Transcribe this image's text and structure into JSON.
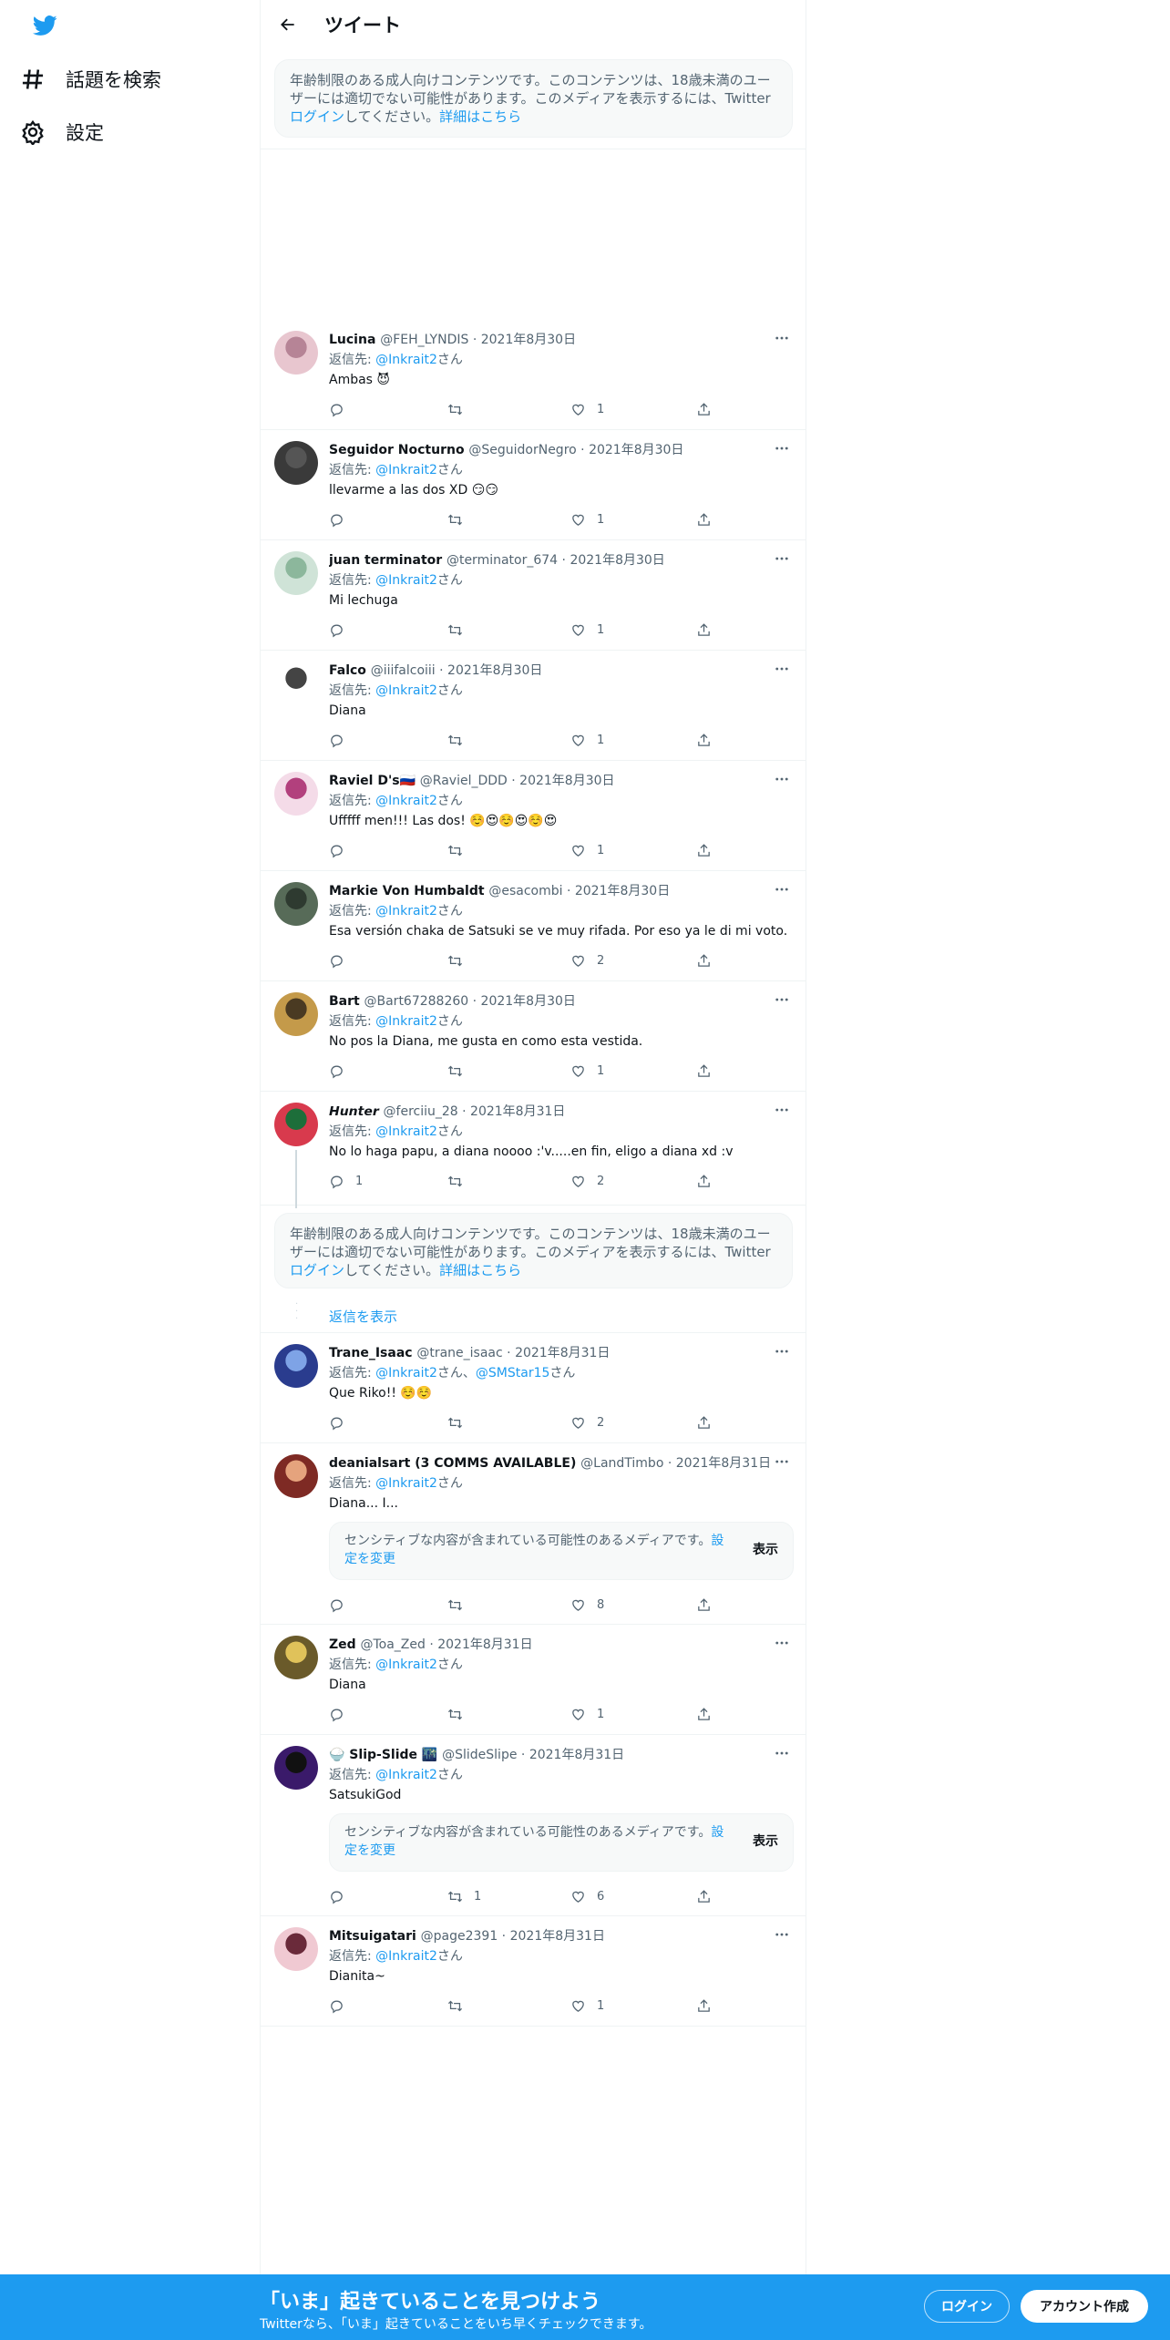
{
  "nav": {
    "explore": "話題を検索",
    "settings": "設定"
  },
  "header": {
    "title": "ツイート"
  },
  "age_notice": {
    "text1": "年齢制限のある成人向けコンテンツです。このコンテンツは、18歳未満のユーザーには適切でない可能性があります。このメディアを表示するには、Twitter",
    "login": "ログイン",
    "text2": "してください。",
    "details": "詳細はこちら"
  },
  "tweets": [
    {
      "name": "Lucina",
      "handle": "@FEH_LYNDIS",
      "date": "2021年8月30日",
      "reply_prefix": "返信先: ",
      "reply_to": "@Inkrait2",
      "reply_suffix": "さん",
      "text": "Ambas 😈",
      "replies": "",
      "retweets": "",
      "likes": "1"
    },
    {
      "name": "Seguidor Nocturno",
      "handle": "@SeguidorNegro",
      "date": "2021年8月30日",
      "reply_prefix": "返信先: ",
      "reply_to": "@Inkrait2",
      "reply_suffix": "さん",
      "text": "llevarme a las dos XD 😏😏",
      "replies": "",
      "retweets": "",
      "likes": "1"
    },
    {
      "name": "juan terminator",
      "handle": "@terminator_674",
      "date": "2021年8月30日",
      "reply_prefix": "返信先: ",
      "reply_to": "@Inkrait2",
      "reply_suffix": "さん",
      "text": "Mi lechuga",
      "replies": "",
      "retweets": "",
      "likes": "1"
    },
    {
      "name": "Falco",
      "handle": "@iiifalcoiii",
      "date": "2021年8月30日",
      "reply_prefix": "返信先: ",
      "reply_to": "@Inkrait2",
      "reply_suffix": "さん",
      "text": "Diana",
      "replies": "",
      "retweets": "",
      "likes": "1"
    },
    {
      "name": "Raviel D's🇷🇺",
      "handle": "@Raviel_DDD",
      "date": "2021年8月30日",
      "reply_prefix": "返信先: ",
      "reply_to": "@Inkrait2",
      "reply_suffix": "さん",
      "text": "Ufffff men!!! Las dos! ☺️😍☺️😍☺️😍",
      "replies": "",
      "retweets": "",
      "likes": "1"
    },
    {
      "name": "Markie Von Humbaldt",
      "handle": "@esacombi",
      "date": "2021年8月30日",
      "reply_prefix": "返信先: ",
      "reply_to": "@Inkrait2",
      "reply_suffix": "さん",
      "text": "Esa versión chaka de Satsuki se ve muy rifada. Por eso ya le di mi voto.",
      "replies": "",
      "retweets": "",
      "likes": "2"
    },
    {
      "name": "Bart",
      "handle": "@Bart67288260",
      "date": "2021年8月30日",
      "reply_prefix": "返信先: ",
      "reply_to": "@Inkrait2",
      "reply_suffix": "さん",
      "text": "No pos la Diana, me gusta en como esta vestida.",
      "replies": "",
      "retweets": "",
      "likes": "1"
    },
    {
      "name": "𝙃𝙪𝙣𝙩𝙚𝙧",
      "handle": "@ferciiu_28",
      "date": "2021年8月31日",
      "reply_prefix": "返信先: ",
      "reply_to": "@Inkrait2",
      "reply_suffix": "さん",
      "text": "No lo haga papu, a diana noooo :'v.....en fin, eligo a diana xd :v",
      "replies": "1",
      "retweets": "",
      "likes": "2"
    },
    {
      "name": "Trane_Isaac",
      "handle": "@trane_isaac",
      "date": "2021年8月31日",
      "reply_prefix": "返信先: ",
      "reply_to": "@Inkrait2",
      "reply_mid": "さん、",
      "reply_to2": "@SMStar15",
      "reply_suffix": "さん",
      "text": "Que Riko!! ☺️☺️",
      "replies": "",
      "retweets": "",
      "likes": "2"
    },
    {
      "name": "deanialsart (3 COMMS AVAILABLE)",
      "handle": "@LandTimbo",
      "date": "2021年8月31日",
      "reply_prefix": "返信先: ",
      "reply_to": "@Inkrait2",
      "reply_suffix": "さん",
      "text": "Diana... I...",
      "replies": "",
      "retweets": "",
      "likes": "8"
    },
    {
      "name": "Zed",
      "handle": "@Toa_Zed",
      "date": "2021年8月31日",
      "reply_prefix": "返信先: ",
      "reply_to": "@Inkrait2",
      "reply_suffix": "さん",
      "text": "Diana",
      "replies": "",
      "retweets": "",
      "likes": "1"
    },
    {
      "name": "🍚 Slip-Slide 🌃",
      "handle": "@SlideSlipe",
      "date": "2021年8月31日",
      "reply_prefix": "返信先: ",
      "reply_to": "@Inkrait2",
      "reply_suffix": "さん",
      "text": "SatsukiGod",
      "replies": "",
      "retweets": "1",
      "likes": "6"
    },
    {
      "name": "Mitsuigatari",
      "handle": "@page2391",
      "date": "2021年8月31日",
      "reply_prefix": "返信先: ",
      "reply_to": "@Inkrait2",
      "reply_suffix": "さん",
      "text": "Dianita~",
      "replies": "",
      "retweets": "",
      "likes": "1"
    }
  ],
  "sensitive": {
    "text": "センシティブな内容が含まれている可能性のあるメディアです。",
    "link": "設定を変更",
    "show": "表示"
  },
  "show_replies": "返信を表示",
  "footer": {
    "title": "「いま」起きていることを見つけよう",
    "subtitle": "Twitterなら、「いま」起きていることをいち早くチェックできます。",
    "login": "ログイン",
    "signup": "アカウント作成"
  },
  "colors": {
    "accent": "#1d9bf0",
    "muted": "#536471"
  },
  "icons": [
    "twitter-bird-icon",
    "hashtag-icon",
    "gear-icon",
    "back-arrow-icon",
    "more-icon",
    "reply-icon",
    "retweet-icon",
    "like-icon",
    "share-icon"
  ]
}
